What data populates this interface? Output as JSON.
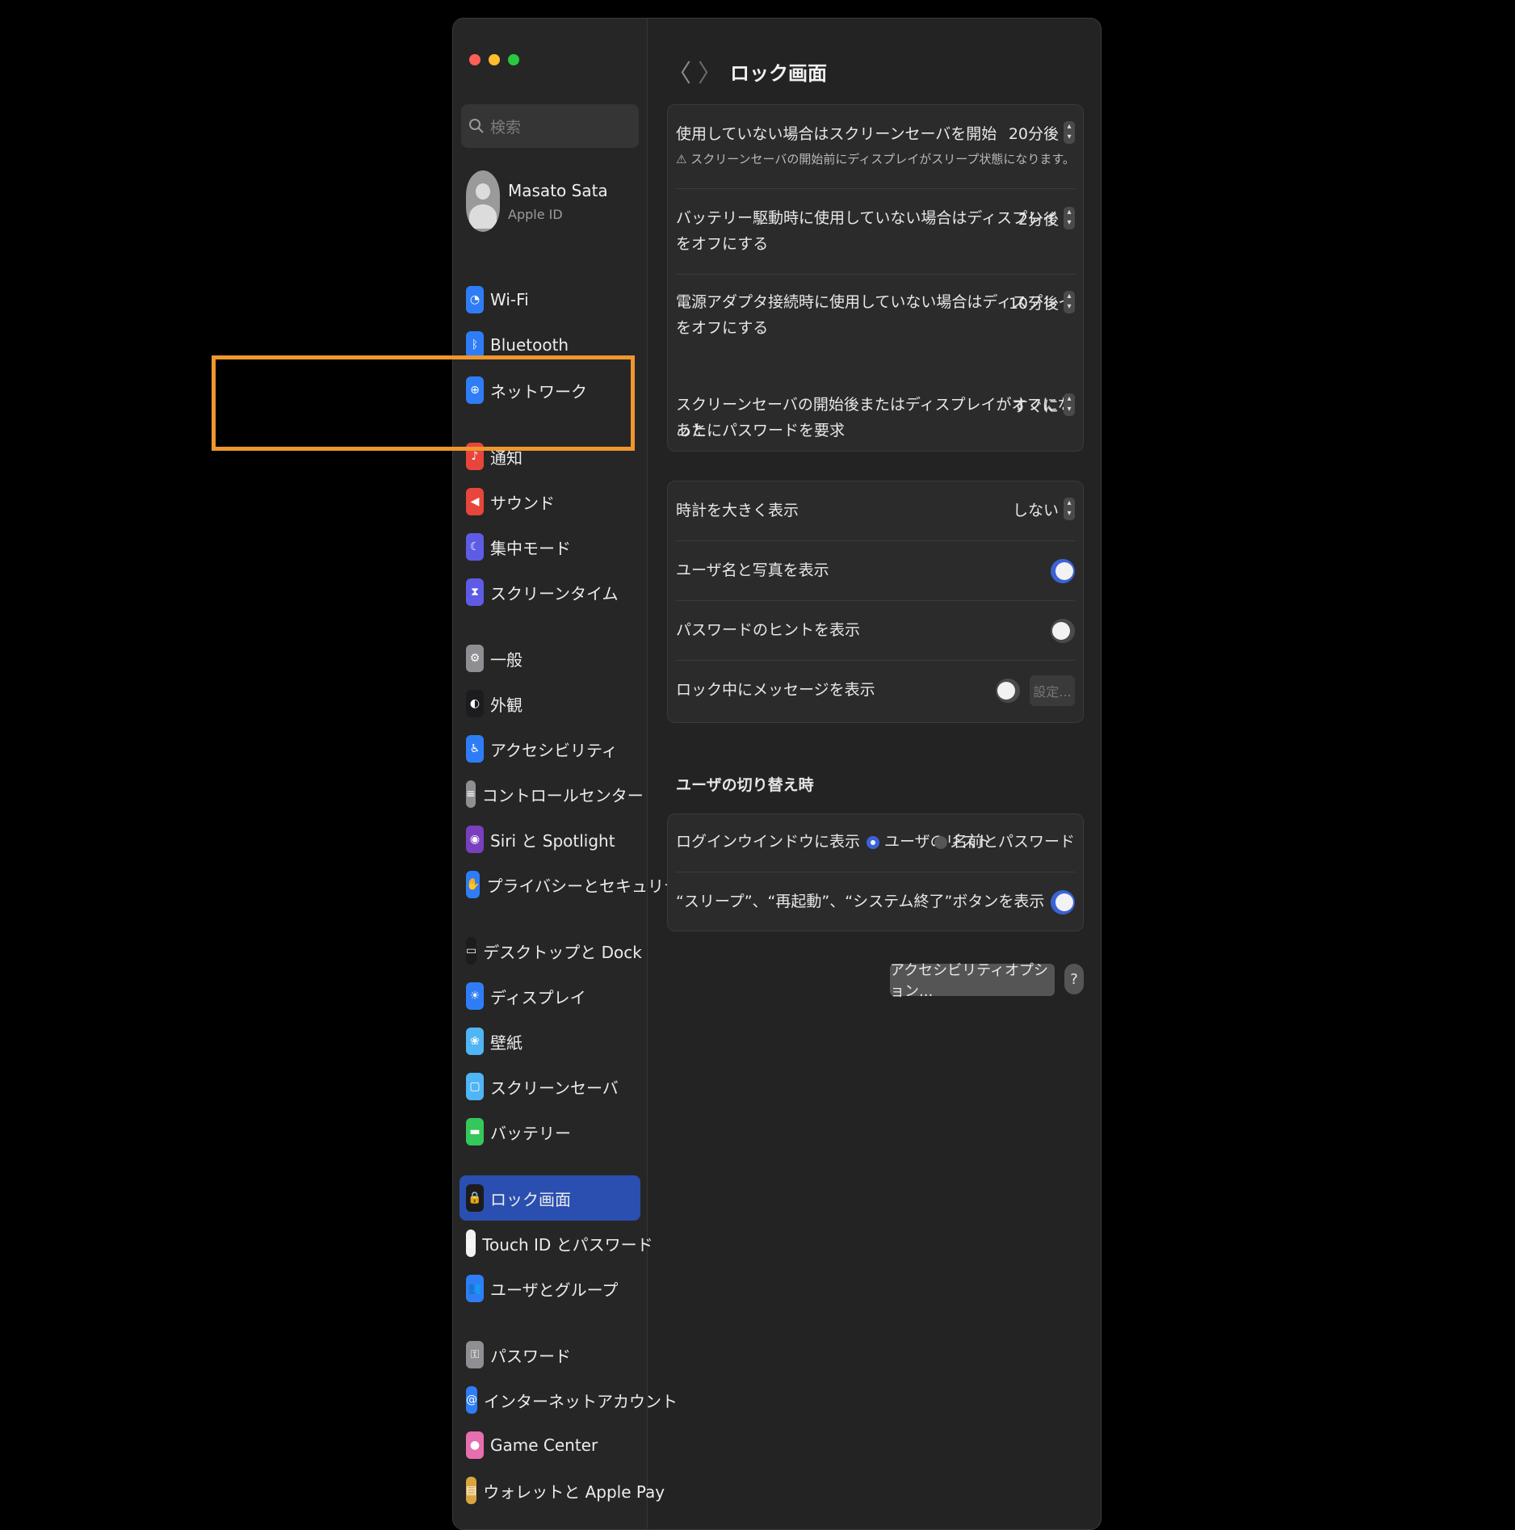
{
  "search": {
    "placeholder": "検索"
  },
  "user": {
    "name": "Masato Sata",
    "subtitle": "Apple ID"
  },
  "sidebar": {
    "items": [
      {
        "label": "Wi-Fi",
        "icon": "wifi-icon",
        "color": "#2f7df6",
        "glyph": "◔"
      },
      {
        "label": "Bluetooth",
        "icon": "bluetooth-icon",
        "color": "#2f7df6",
        "glyph": "ᛒ"
      },
      {
        "label": "ネットワーク",
        "icon": "globe-icon",
        "color": "#2f7df6",
        "glyph": "⊕"
      },
      {
        "label": "通知",
        "icon": "bell-icon",
        "color": "#e8453c",
        "glyph": "♪"
      },
      {
        "label": "サウンド",
        "icon": "speaker-icon",
        "color": "#e8453c",
        "glyph": "◀"
      },
      {
        "label": "集中モード",
        "icon": "moon-icon",
        "color": "#5e5ce6",
        "glyph": "☾"
      },
      {
        "label": "スクリーンタイム",
        "icon": "hourglass-icon",
        "color": "#5e5ce6",
        "glyph": "⧗"
      },
      {
        "label": "一般",
        "icon": "gear-icon",
        "color": "#8e8e93",
        "glyph": "⚙"
      },
      {
        "label": "外観",
        "icon": "appearance-icon",
        "color": "#1c1c1e",
        "glyph": "◐"
      },
      {
        "label": "アクセシビリティ",
        "icon": "accessibility-icon",
        "color": "#2f7df6",
        "glyph": "♿"
      },
      {
        "label": "コントロールセンター",
        "icon": "control-center-icon",
        "color": "#8e8e93",
        "glyph": "≡"
      },
      {
        "label": "Siri と Spotlight",
        "icon": "siri-icon",
        "color": "#7a3fbf",
        "glyph": "◉"
      },
      {
        "label": "プライバシーとセキュリティ",
        "icon": "hand-icon",
        "color": "#2f7df6",
        "glyph": "✋"
      },
      {
        "label": "デスクトップと Dock",
        "icon": "dock-icon",
        "color": "#1c1c1e",
        "glyph": "▭"
      },
      {
        "label": "ディスプレイ",
        "icon": "sun-icon",
        "color": "#2f7df6",
        "glyph": "☀"
      },
      {
        "label": "壁紙",
        "icon": "flower-icon",
        "color": "#4fb5f5",
        "glyph": "❀"
      },
      {
        "label": "スクリーンセーバ",
        "icon": "screensaver-icon",
        "color": "#4fb5f5",
        "glyph": "▢"
      },
      {
        "label": "バッテリー",
        "icon": "battery-icon",
        "color": "#34c759",
        "glyph": "▬"
      },
      {
        "label": "ロック画面",
        "icon": "lock-icon",
        "color": "#1c1c1e",
        "glyph": "🔒"
      },
      {
        "label": "Touch ID とパスワード",
        "icon": "fingerprint-icon",
        "color": "#f2f2f2",
        "glyph": "◎"
      },
      {
        "label": "ユーザとグループ",
        "icon": "users-icon",
        "color": "#2f7df6",
        "glyph": "👥"
      },
      {
        "label": "パスワード",
        "icon": "key-icon",
        "color": "#8e8e93",
        "glyph": "⚿"
      },
      {
        "label": "インターネットアカウント",
        "icon": "at-icon",
        "color": "#2f7df6",
        "glyph": "@"
      },
      {
        "label": "Game Center",
        "icon": "game-center-icon",
        "color": "#e66fb0",
        "glyph": "●"
      },
      {
        "label": "ウォレットと Apple Pay",
        "icon": "wallet-icon",
        "color": "#d9a441",
        "glyph": "▤"
      }
    ],
    "active_index": 18
  },
  "header": {
    "title": "ロック画面",
    "back_glyph": "〈",
    "forward_glyph": "〉"
  },
  "group1": {
    "rows": [
      {
        "label1": "使用していない場合はスクリーンセーバを開始",
        "label2": "",
        "value": "20分後",
        "warning": "⚠ スクリーンセーバの開始前にディスプレイがスリープ状態になります。"
      },
      {
        "label1": "バッテリー駆動時に使用していない場合はディスプレイ",
        "label2": "をオフにする",
        "value": "2分後"
      },
      {
        "label1": "電源アダプタ接続時に使用していない場合はディスプレイ",
        "label2": "をオフにする",
        "value": "10分後"
      },
      {
        "label1": "スクリーンセーバの開始後またはディスプレイがオフになった",
        "label2": "あとにパスワードを要求",
        "value": "すぐに"
      }
    ]
  },
  "group2": {
    "clock_label": "時計を大きく表示",
    "clock_value": "しない",
    "show_name_label": "ユーザ名と写真を表示",
    "show_name_on": true,
    "hint_label": "パスワードのヒントを表示",
    "hint_on": false,
    "message_label": "ロック中にメッセージを表示",
    "message_on": false,
    "message_button": "設定..."
  },
  "switch_section": {
    "title": "ユーザの切り替え時",
    "login_label": "ログインウインドウに表示",
    "option_list": "ユーザのリスト",
    "option_name": "名前とパスワード",
    "selected": "ユーザのリスト",
    "buttons_label": "“スリープ”、“再起動”、“システム終了”ボタンを表示",
    "buttons_on": true
  },
  "footer": {
    "accessibility_button": "アクセシビリティオプション...",
    "help": "?"
  },
  "stepper_glyph": "▴▾"
}
